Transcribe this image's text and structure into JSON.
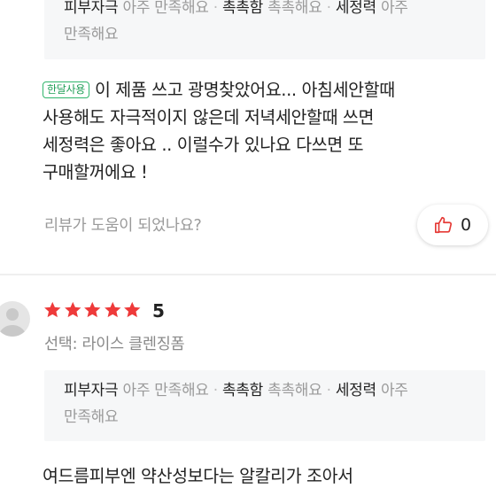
{
  "review1": {
    "attributes_line1": [
      {
        "key": "피부자극",
        "value": "아주 만족해요"
      },
      {
        "key": "촉촉함",
        "value": "촉촉해요"
      },
      {
        "key": "세정력",
        "value": "아주"
      }
    ],
    "attributes_line2": "만족해요",
    "badge": "한달사용",
    "text_line1": "이 제품 쓰고 광명찾았어요... 아침세안할때",
    "text_line2": "사용해도 자극적이지 않은데 저녁세안할때 쓰면",
    "text_line3": "세정력은 좋아요 .. 이럴수가 있나요 다쓰면 또",
    "text_line4": "구매할꺼에요 !",
    "helpful_prompt": "리뷰가 도움이 되었나요?",
    "like_count": "0"
  },
  "review2": {
    "rating": 5,
    "rating_label": "5",
    "option": "선택: 라이스 클렌징폼",
    "attributes_line1": [
      {
        "key": "피부자극",
        "value": "아주 만족해요"
      },
      {
        "key": "촉촉함",
        "value": "촉촉해요"
      },
      {
        "key": "세정력",
        "value": "아주"
      }
    ],
    "attributes_line2": "만족해요",
    "text_line1": "여드름피부엔 약산성보다는 알칼리가 조아서"
  },
  "colors": {
    "star": "#ee3a3a",
    "badge": "#2fb56b",
    "like_icon": "#e53935"
  },
  "icons": {
    "like": "thumbs-up-icon",
    "star": "star-icon",
    "avatar": "avatar"
  }
}
